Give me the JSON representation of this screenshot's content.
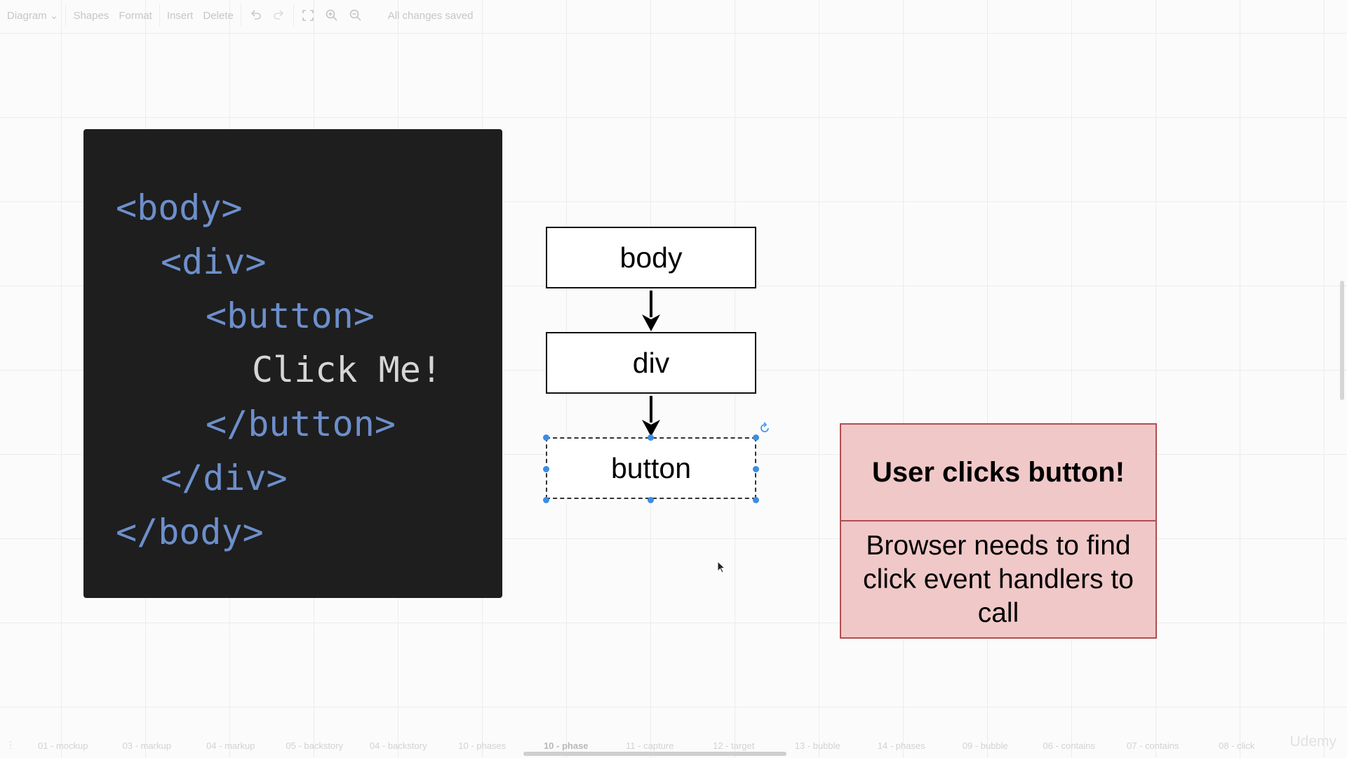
{
  "toolbar": {
    "diagram_menu": "Diagram",
    "shapes": "Shapes",
    "format": "Format",
    "insert": "Insert",
    "delete": "Delete",
    "status": "All changes saved"
  },
  "code": {
    "lines": [
      "<body>",
      "<div>",
      "<button>",
      "Click Me!",
      "</button>",
      "</div>",
      "</body>"
    ]
  },
  "flow": {
    "nodes": [
      "body",
      "div",
      "button"
    ]
  },
  "callout": {
    "title": "User clicks button!",
    "body": "Browser needs to find click event handlers to call"
  },
  "pages": {
    "tabs": [
      "01 - mockup",
      "03 - markup",
      "04 - markup",
      "05 - backstory",
      "04 - backstory",
      "10 - phases",
      "10 - phase",
      "11 - capture",
      "12 - target",
      "13 - bubble",
      "14 - phases",
      "09 - bubble",
      "06 - contains",
      "07 - contains",
      "08 - click"
    ],
    "active_tab": "10 - phase"
  },
  "watermark": "Udemy",
  "colors": {
    "code_bg": "#1e1e1e",
    "code_tag": "#6d8fcb",
    "code_text": "#d6d6d6",
    "callout_fill": "#f0c8c8",
    "callout_border": "#b04f4f",
    "selection_handle": "#3b8de4"
  },
  "icons": [
    "dropdown-chevron-icon",
    "undo-icon",
    "redo-icon",
    "fullscreen-icon",
    "zoom-in-icon",
    "zoom-out-icon",
    "rotate-icon",
    "cursor-icon",
    "page-menu-icon"
  ]
}
